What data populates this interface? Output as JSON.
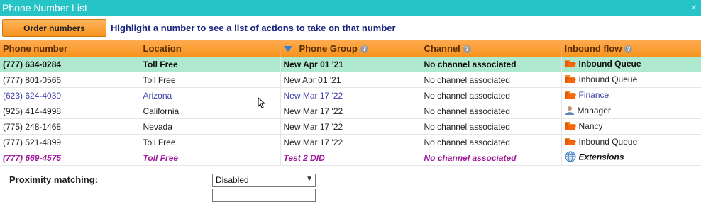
{
  "window": {
    "title": "Phone Number List",
    "close_glyph": "×"
  },
  "toolbar": {
    "order_label": "Order numbers",
    "hint": "Highlight a number to see a list of actions to take on that number"
  },
  "table": {
    "columns": [
      {
        "label": "Phone number",
        "help": false,
        "sorted": false
      },
      {
        "label": "Location",
        "help": false,
        "sorted": false
      },
      {
        "label": "Phone Group",
        "help": true,
        "sorted": true
      },
      {
        "label": "Channel",
        "help": true,
        "sorted": false
      },
      {
        "label": "Inbound flow",
        "help": true,
        "sorted": false
      }
    ],
    "rows": [
      {
        "phone": "(777) 634-0284",
        "location": "Toll Free",
        "group": "New Apr 01 '21",
        "channel": "No channel associated",
        "flow": "Inbound Queue",
        "flow_icon": "folder-icon",
        "style": "selected"
      },
      {
        "phone": "(777) 801-0566",
        "location": "Toll Free",
        "group": "New Apr 01 '21",
        "channel": "No channel associated",
        "flow": "Inbound Queue",
        "flow_icon": "folder-icon",
        "style": "normal"
      },
      {
        "phone": "(623) 624-4030",
        "location": "Arizona",
        "group": "New Mar 17 '22",
        "channel": "No channel associated",
        "flow": "Finance",
        "flow_icon": "folder-icon",
        "style": "blue"
      },
      {
        "phone": "(925) 414-4998",
        "location": "California",
        "group": "New Mar 17 '22",
        "channel": "No channel associated",
        "flow": "Manager",
        "flow_icon": "user-icon",
        "style": "normal"
      },
      {
        "phone": "(775) 248-1468",
        "location": "Nevada",
        "group": "New Mar 17 '22",
        "channel": "No channel associated",
        "flow": "Nancy",
        "flow_icon": "folder-icon",
        "style": "normal"
      },
      {
        "phone": "(777) 521-4899",
        "location": "Toll Free",
        "group": "New Mar 17 '22",
        "channel": "No channel associated",
        "flow": "Inbound Queue",
        "flow_icon": "folder-icon",
        "style": "normal"
      },
      {
        "phone": "(777) 669-4575",
        "location": "Toll Free",
        "group": "Test 2 DID",
        "channel": "No channel associated",
        "flow": "Extensions",
        "flow_icon": "globe-icon",
        "style": "magenta"
      }
    ]
  },
  "settings": {
    "proximity_label": "Proximity matching:",
    "proximity_value": "Disabled"
  },
  "colors": {
    "titlebar": "#26c3c7",
    "header_orange": "#f7941e",
    "selected_row": "#aee9cf",
    "link_blue": "#3f3fa8",
    "magenta": "#a0199b"
  }
}
